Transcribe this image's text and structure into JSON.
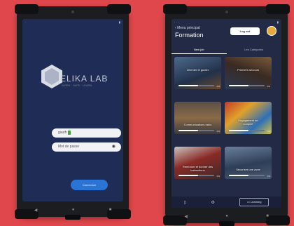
{
  "colors": {
    "background": "#e0474c",
    "login_bg": "#1f2c55",
    "app_bg": "#232a45",
    "accent": "#2a74d6"
  },
  "login": {
    "brand": "ELIKA LAB",
    "tagline": "WORK · SAFE · LEARN",
    "username_value": "gauth",
    "password_placeholder": "Mot de passe",
    "login_button": "Connexion"
  },
  "app": {
    "back_label": "Menu principal",
    "title": "Formation",
    "logout_label": "Log out",
    "tabs": [
      {
        "label": "New job"
      },
      {
        "label": "Les Catégories"
      }
    ],
    "cards": [
      {
        "title": "Orienter et guider",
        "progress": 0.55,
        "pct_label": "0%"
      },
      {
        "title": "Premiers secours",
        "progress": 0.55,
        "pct_label": "0%"
      },
      {
        "title": "Communications radio",
        "progress": 0.55,
        "pct_label": "0%"
      },
      {
        "title": "Engagement de\ncomplet",
        "progress": 0.55,
        "pct_label": "0%"
      },
      {
        "title": "Renforcer et donner des\ninstructions",
        "progress": 0.55,
        "pct_label": "0%"
      },
      {
        "title": "Sécuriser une zone",
        "progress": 0.55,
        "pct_label": "0%"
      }
    ],
    "bottom": {
      "learning_label": "Learning"
    }
  }
}
